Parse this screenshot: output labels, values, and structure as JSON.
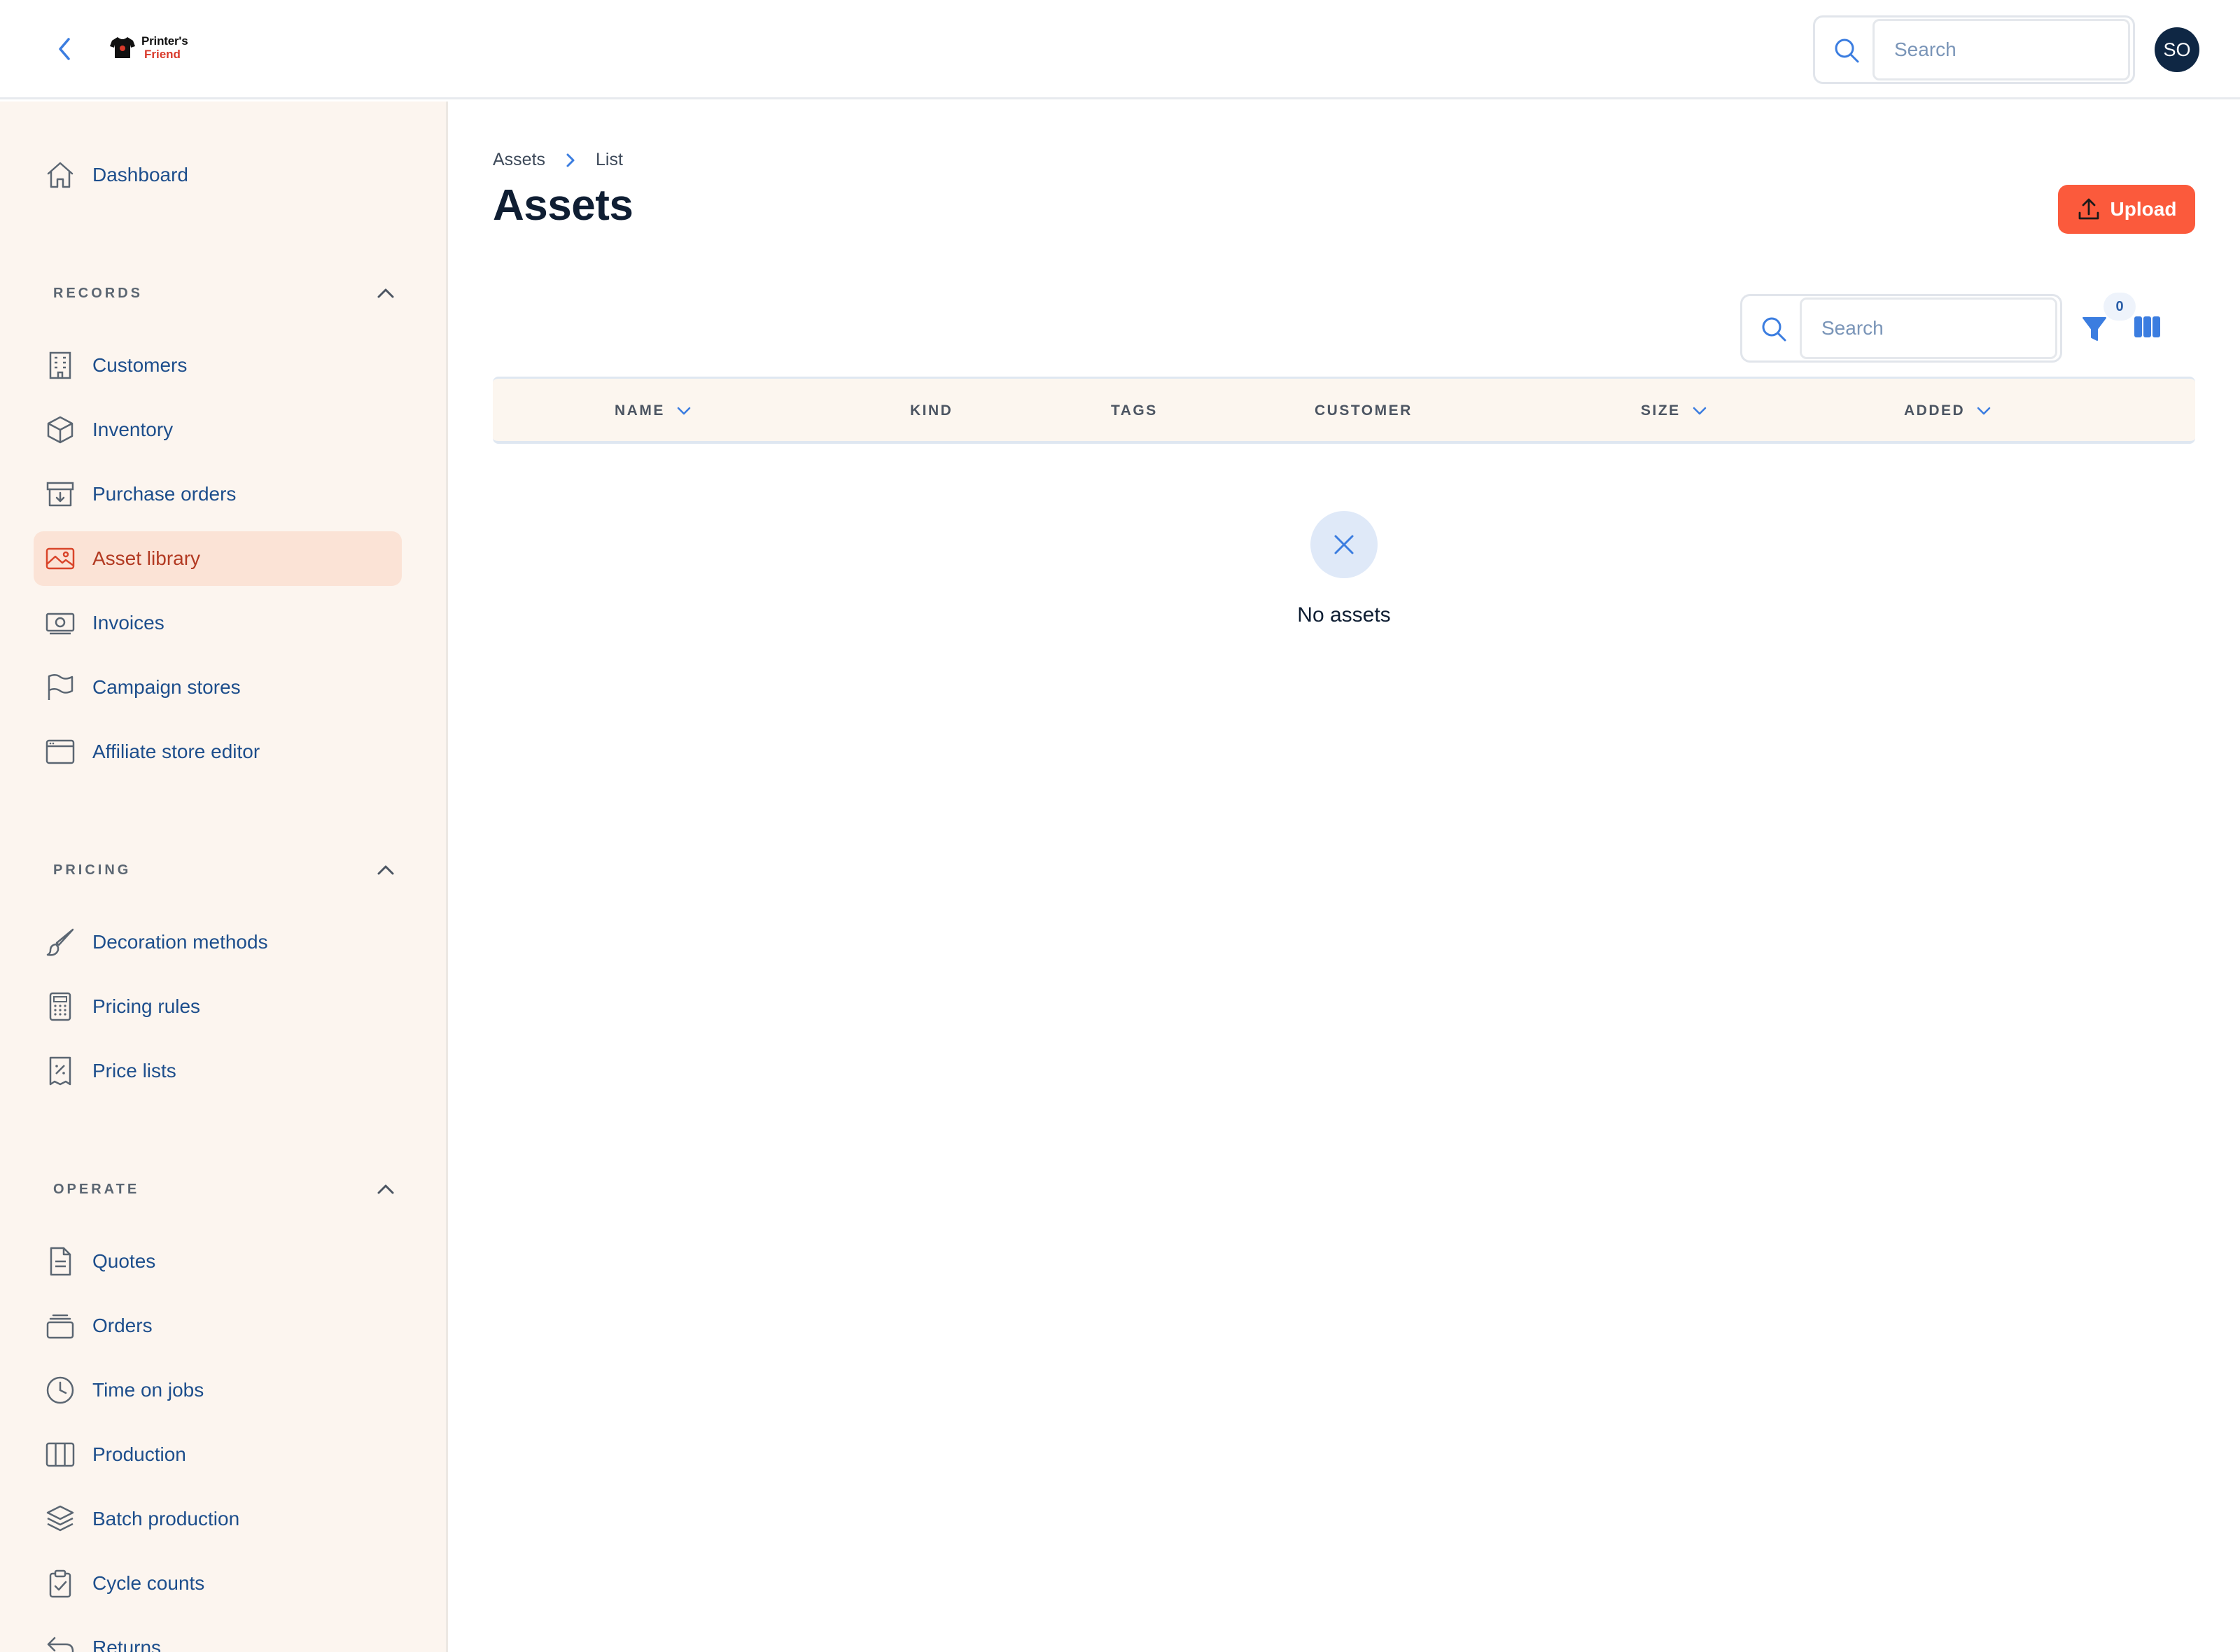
{
  "header": {
    "logo_line1": "Printer's",
    "logo_line2": "Friend",
    "search_placeholder": "Search",
    "avatar_initials": "SO"
  },
  "sidebar": {
    "dashboard": "Dashboard",
    "sections": {
      "records": "RECORDS",
      "pricing": "PRICING",
      "operate": "OPERATE"
    },
    "records_items": [
      "Customers",
      "Inventory",
      "Purchase orders",
      "Asset library",
      "Invoices",
      "Campaign stores",
      "Affiliate store editor"
    ],
    "pricing_items": [
      "Decoration methods",
      "Pricing rules",
      "Price lists"
    ],
    "operate_items": [
      "Quotes",
      "Orders",
      "Time on jobs",
      "Production",
      "Batch production",
      "Cycle counts",
      "Returns"
    ],
    "active_item": "Asset library"
  },
  "main": {
    "breadcrumb": [
      "Assets",
      "List"
    ],
    "title": "Assets",
    "upload_label": "Upload",
    "search_placeholder": "Search",
    "filter_count": "0",
    "columns": [
      "NAME",
      "KIND",
      "TAGS",
      "CUSTOMER",
      "SIZE",
      "ADDED"
    ],
    "empty_text": "No assets"
  },
  "colors": {
    "accent": "#fb5a3c",
    "sidebar_bg": "#fcf5ef",
    "active_bg": "#fbe3d6",
    "link": "#1d4e8c",
    "filter_blue": "#3b7de0"
  }
}
